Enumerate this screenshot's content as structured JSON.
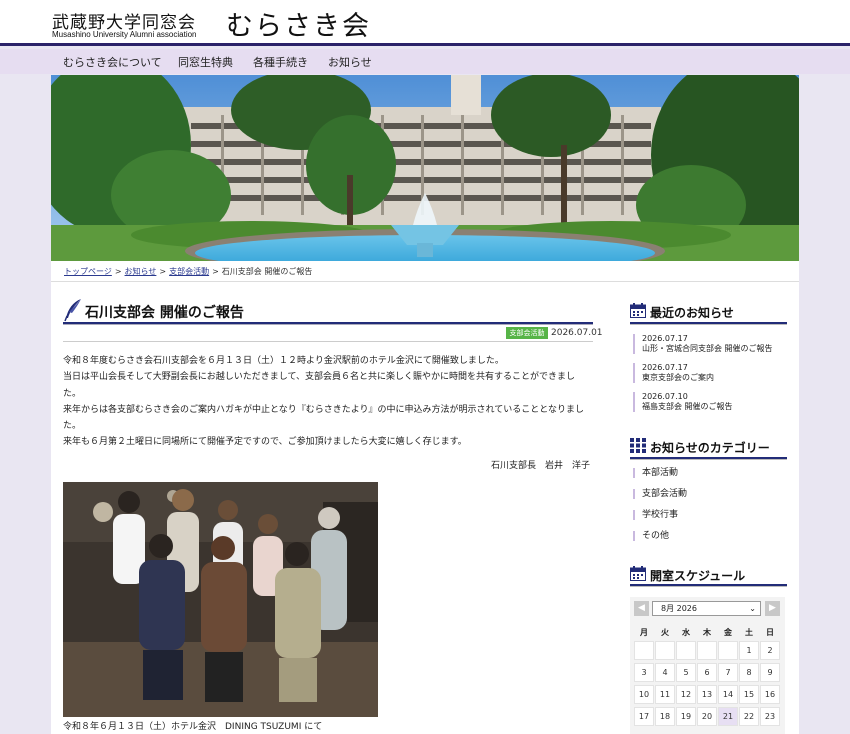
{
  "header": {
    "logo_jp": "武蔵野大学同窓会",
    "logo_en": "Musashino University Alumni association",
    "logo_big": "むらさき会"
  },
  "nav": {
    "items": [
      {
        "label": "むらさき会について"
      },
      {
        "label": "同窓生特典"
      },
      {
        "label": "各種手続き"
      },
      {
        "label": "お知らせ"
      }
    ]
  },
  "breadcrumb": {
    "items": [
      "トップページ",
      "お知らせ",
      "支部会活動"
    ],
    "current": "石川支部会 開催のご報告"
  },
  "post": {
    "title": "石川支部会 開催のご報告",
    "category": "支部会活動",
    "date": "2026.07.01",
    "paragraphs": [
      "令和８年度むらさき会石川支部会を６月１３日（土）１２時より金沢駅前のホテル金沢にて開催致しました。",
      "当日は平山会長そして大野副会長にお越しいただきまして、支部会員６名と共に楽しく賑やかに時間を共有することができまし",
      "た。",
      "来年からは各支部むらさき会のご案内ハガキが中止となり『むらさきたより』の中に申込み方法が明示されていることとなりまし",
      "た。",
      "来年も６月第２土曜日に同場所にて開催予定ですので、ご参加頂けましたら大変に嬉しく存じます。"
    ],
    "signature": "石川支部長　岩井　洋子",
    "caption": "令和８年６月１３日（土）ホテル金沢　DINING TSUZUMI にて"
  },
  "sidebar": {
    "recent_title": "最近のお知らせ",
    "recent": [
      {
        "date": "2026.07.17",
        "title": "山形・宮城合同支部会 開催のご報告"
      },
      {
        "date": "2026.07.17",
        "title": "東京支部会のご案内"
      },
      {
        "date": "2026.07.10",
        "title": "福島支部会 開催のご報告"
      }
    ],
    "categories_title": "お知らせのカテゴリー",
    "categories": [
      "本部活動",
      "支部会活動",
      "学校行事",
      "その他"
    ],
    "schedule_title": "開室スケジュール"
  },
  "calendar": {
    "prev": "◀",
    "next": "▶",
    "month": "8月 2026",
    "weekdays": [
      "月",
      "火",
      "水",
      "木",
      "金",
      "土",
      "日"
    ],
    "rows": [
      [
        "",
        "",
        "",
        "",
        "",
        "1",
        "2"
      ],
      [
        "3",
        "4",
        "5",
        "6",
        "7",
        "8",
        "9"
      ],
      [
        "10",
        "11",
        "12",
        "13",
        "14",
        "15",
        "16"
      ],
      [
        "17",
        "18",
        "19",
        "20",
        "21",
        "22",
        "23"
      ]
    ],
    "highlight": "21"
  },
  "colors": {
    "navy": "#222c78",
    "nav_bg": "#e6ddf1",
    "page_bg": "#e9e6f2",
    "badge_green": "#57b447"
  },
  "icons": {
    "title": "quill-icon",
    "sidebar": "calendar-icon",
    "categories": "grid-icon"
  }
}
